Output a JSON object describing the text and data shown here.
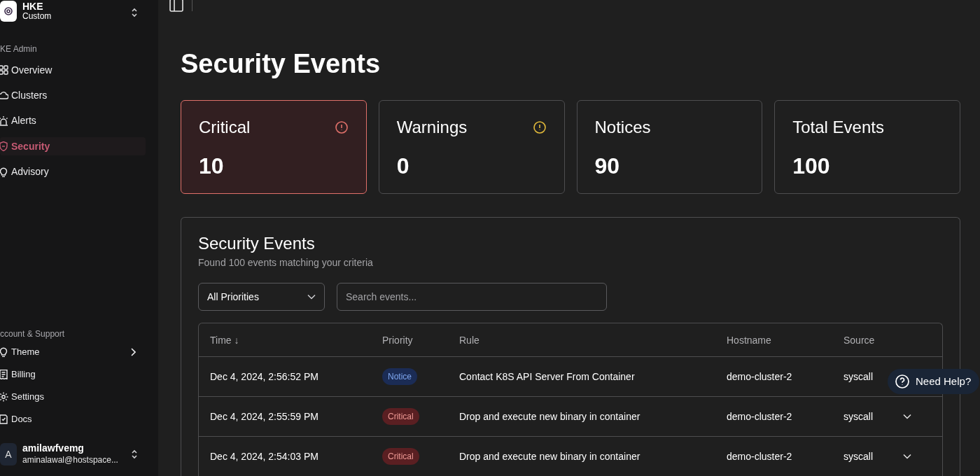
{
  "sidebar": {
    "brand": {
      "name": "HKE",
      "subtitle": "Custom"
    },
    "sections": [
      {
        "heading": "KE Admin",
        "items": [
          {
            "label": "Overview",
            "selected": false
          },
          {
            "label": "Clusters",
            "selected": false
          },
          {
            "label": "Alerts",
            "selected": false
          },
          {
            "label": "Security",
            "selected": true
          },
          {
            "label": "Advisory",
            "selected": false
          }
        ]
      },
      {
        "heading": "ccount & Support",
        "items": [
          {
            "label": "Theme",
            "selected": false,
            "submenu": true
          },
          {
            "label": "Billing",
            "selected": false,
            "submenu": false
          },
          {
            "label": "Settings",
            "selected": false,
            "submenu": false
          },
          {
            "label": "Docs",
            "selected": false,
            "submenu": false
          }
        ]
      }
    ],
    "user": {
      "initial": "A",
      "name": "amilawfvemg",
      "email": "aminalawal@hostspace..."
    }
  },
  "page_title": "Security Events",
  "stat_cards": [
    {
      "label": "Critical",
      "value": "10",
      "kind": "critical"
    },
    {
      "label": "Warnings",
      "value": "0",
      "kind": "warning"
    },
    {
      "label": "Notices",
      "value": "90",
      "kind": "plain"
    },
    {
      "label": "Total Events",
      "value": "100",
      "kind": "plain"
    }
  ],
  "events_panel": {
    "title": "Security Events",
    "subtitle": "Found 100 events matching your criteria",
    "filter": {
      "value": "All Priorities"
    },
    "search": {
      "placeholder": "Search events..."
    },
    "table": {
      "columns": [
        "Time ↓",
        "Priority",
        "Rule",
        "Hostname",
        "Source"
      ],
      "rows": [
        {
          "time": "Dec 4, 2024, 2:56:52 PM",
          "priority": {
            "label": "Notice",
            "kind": "notice"
          },
          "rule": "Contact K8S API Server From Container",
          "hostname": "demo-cluster-2",
          "source": "syscall",
          "expand_control": false
        },
        {
          "time": "Dec 4, 2024, 2:55:59 PM",
          "priority": {
            "label": "Critical",
            "kind": "critical"
          },
          "rule": "Drop and execute new binary in container",
          "hostname": "demo-cluster-2",
          "source": "syscall",
          "expand_control": true
        },
        {
          "time": "Dec 4, 2024, 2:54:03 PM",
          "priority": {
            "label": "Critical",
            "kind": "critical"
          },
          "rule": "Drop and execute new binary in container",
          "hostname": "demo-cluster-2",
          "source": "syscall",
          "expand_control": true
        }
      ]
    }
  },
  "help_button": {
    "label": "Need Help?"
  }
}
